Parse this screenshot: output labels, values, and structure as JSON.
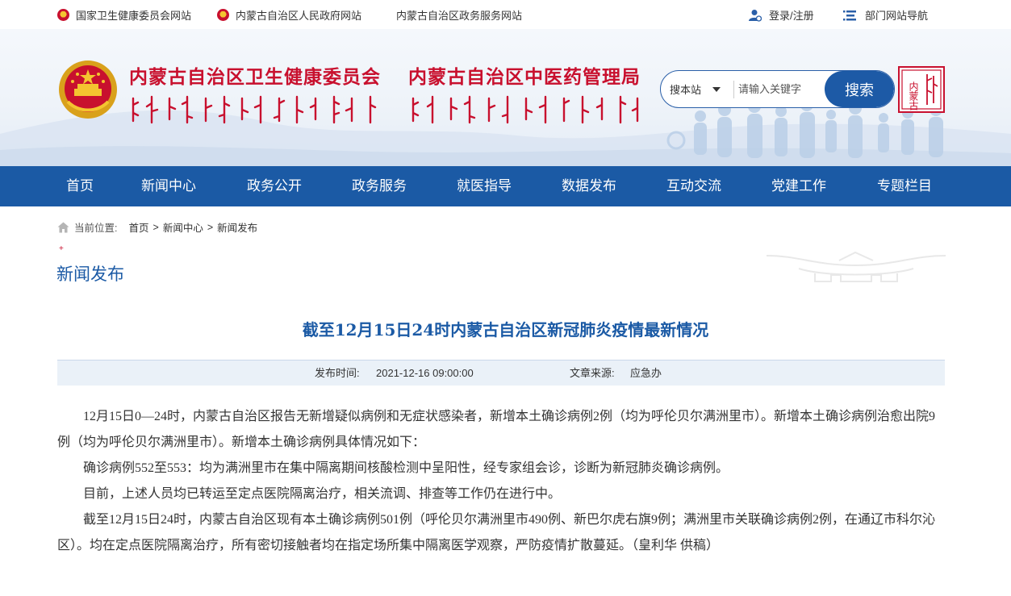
{
  "topbar": {
    "link1": "国家卫生健康委员会网站",
    "link2": "内蒙古自治区人民政府网站",
    "link3": "内蒙古自治区政务服务网站",
    "login": "登录/注册",
    "dept_nav": "部门网站导航"
  },
  "header": {
    "title1": "内蒙古自治区卫生健康委员会",
    "title2": "内蒙古自治区中医药管理局",
    "search_scope": "搜本站",
    "search_placeholder": "请输入关键字",
    "search_button": "搜索",
    "seal_text": "内蒙古"
  },
  "nav": {
    "items": [
      "首页",
      "新闻中心",
      "政务公开",
      "政务服务",
      "就医指导",
      "数据发布",
      "互动交流",
      "党建工作",
      "专题栏目"
    ]
  },
  "breadcrumb": {
    "label": "当前位置:",
    "items": [
      "首页",
      "新闻中心",
      "新闻发布"
    ]
  },
  "section_title": "新闻发布",
  "article": {
    "title": "截至12月15日24时内蒙古自治区新冠肺炎疫情最新情况",
    "publish_label": "发布时间:",
    "publish_time": "2021-12-16 09:00:00",
    "source_label": "文章来源:",
    "source": "应急办",
    "paragraphs": [
      "12月15日0—24时，内蒙古自治区报告无新增疑似病例和无症状感染者，新增本土确诊病例2例（均为呼伦贝尔满洲里市）。新增本土确诊病例治愈出院9例（均为呼伦贝尔满洲里市）。新增本土确诊病例具体情况如下：",
      "确诊病例552至553：均为满洲里市在集中隔离期间核酸检测中呈阳性，经专家组会诊，诊断为新冠肺炎确诊病例。",
      "目前，上述人员均已转运至定点医院隔离治疗，相关流调、排查等工作仍在进行中。",
      "截至12月15日24时，内蒙古自治区现有本土确诊病例501例（呼伦贝尔满洲里市490例、新巴尔虎右旗9例；满洲里市关联确诊病例2例，在通辽市科尔沁区）。均在定点医院隔离治疗，所有密切接触者均在指定场所集中隔离医学观察，严防疫情扩散蔓延。（皇利华 供稿）"
    ]
  },
  "colors": {
    "brand_blue": "#1b5aa5",
    "title_red": "#c8102e"
  }
}
